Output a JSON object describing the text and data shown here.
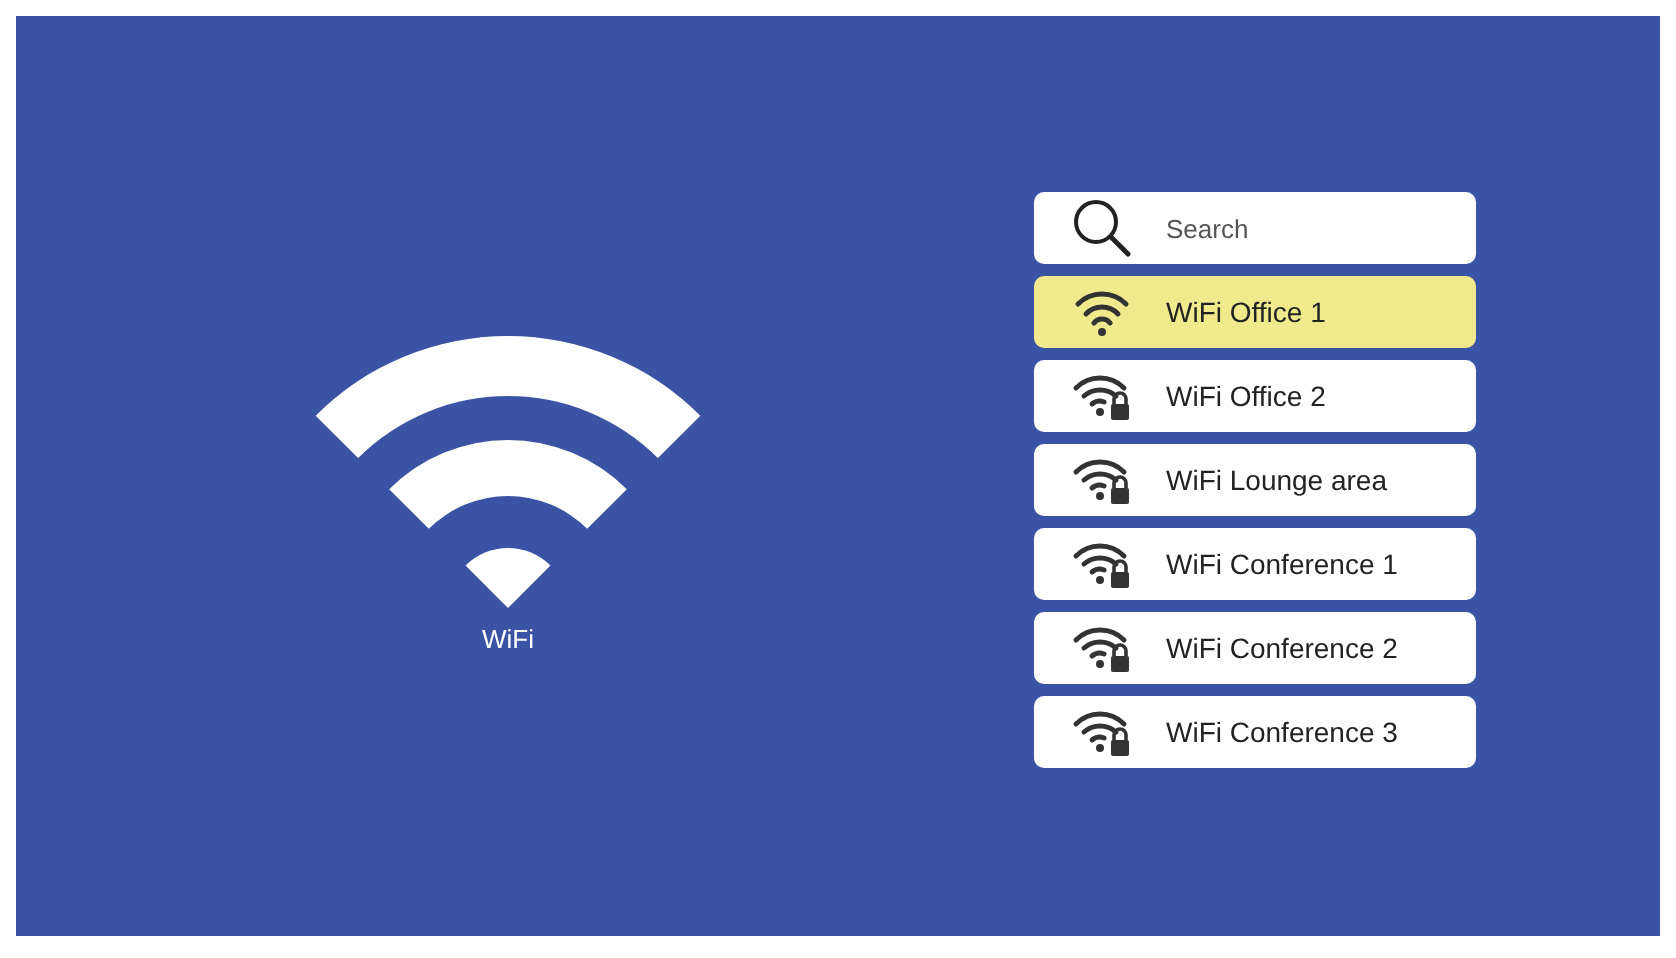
{
  "logo": {
    "caption": "WiFi"
  },
  "search": {
    "placeholder": "Search"
  },
  "networks": [
    {
      "name": "WiFi Office 1",
      "selected": true,
      "locked": false
    },
    {
      "name": "WiFi Office 2",
      "selected": false,
      "locked": true
    },
    {
      "name": "WiFi Lounge area",
      "selected": false,
      "locked": true
    },
    {
      "name": "WiFi Conference 1",
      "selected": false,
      "locked": true
    },
    {
      "name": "WiFi Conference 2",
      "selected": false,
      "locked": true
    },
    {
      "name": "WiFi Conference 3",
      "selected": false,
      "locked": true
    }
  ]
}
